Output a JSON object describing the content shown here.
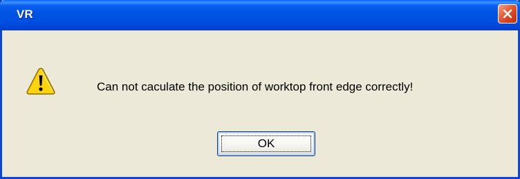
{
  "window": {
    "title": "VR",
    "close_icon": "close-icon"
  },
  "dialog": {
    "icon": "warning-icon",
    "message": "Can not caculate the position of worktop front edge correctly!",
    "ok_label": "OK"
  },
  "colors": {
    "titlebar_blue": "#0054e3",
    "border_blue": "#0a45d8",
    "dialog_background": "#ece9d8",
    "close_button_red": "#e5603b",
    "warning_yellow": "#fbd40c"
  }
}
